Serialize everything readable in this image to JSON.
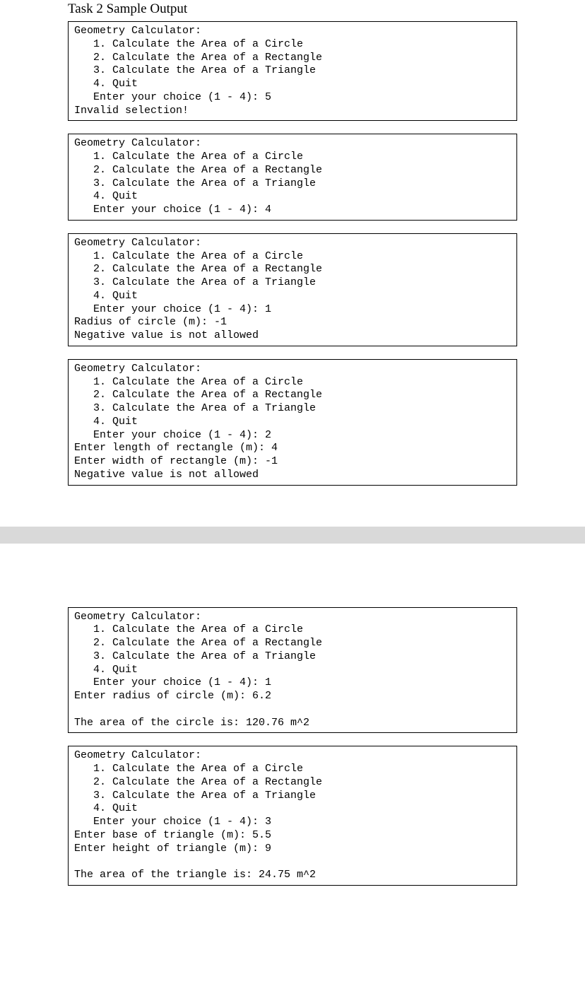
{
  "heading": "Task 2 Sample Output",
  "box1": "Geometry Calculator:\n   1. Calculate the Area of a Circle\n   2. Calculate the Area of a Rectangle\n   3. Calculate the Area of a Triangle\n   4. Quit\n   Enter your choice (1 - 4): 5\nInvalid selection!",
  "box2": "Geometry Calculator:\n   1. Calculate the Area of a Circle\n   2. Calculate the Area of a Rectangle\n   3. Calculate the Area of a Triangle\n   4. Quit\n   Enter your choice (1 - 4): 4",
  "box3": "Geometry Calculator:\n   1. Calculate the Area of a Circle\n   2. Calculate the Area of a Rectangle\n   3. Calculate the Area of a Triangle\n   4. Quit\n   Enter your choice (1 - 4): 1\nRadius of circle (m): -1\nNegative value is not allowed",
  "box4": "Geometry Calculator:\n   1. Calculate the Area of a Circle\n   2. Calculate the Area of a Rectangle\n   3. Calculate the Area of a Triangle\n   4. Quit\n   Enter your choice (1 - 4): 2\nEnter length of rectangle (m): 4\nEnter width of rectangle (m): -1\nNegative value is not allowed",
  "box5": "Geometry Calculator:\n   1. Calculate the Area of a Circle\n   2. Calculate the Area of a Rectangle\n   3. Calculate the Area of a Triangle\n   4. Quit\n   Enter your choice (1 - 4): 1\nEnter radius of circle (m): 6.2\n\nThe area of the circle is: 120.76 m^2",
  "box6": "Geometry Calculator:\n   1. Calculate the Area of a Circle\n   2. Calculate the Area of a Rectangle\n   3. Calculate the Area of a Triangle\n   4. Quit\n   Enter your choice (1 - 4): 3\nEnter base of triangle (m): 5.5\nEnter height of triangle (m): 9\n\nThe area of the triangle is: 24.75 m^2"
}
